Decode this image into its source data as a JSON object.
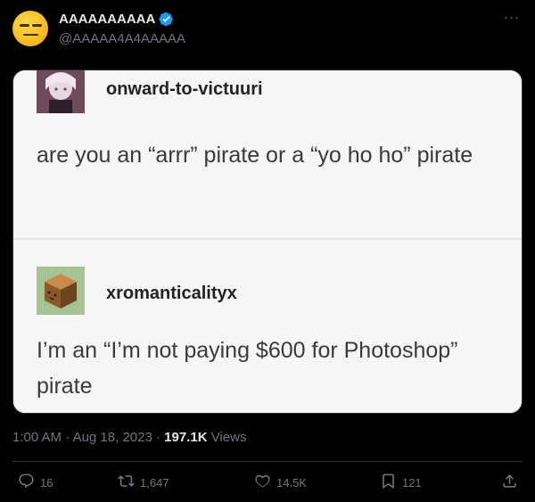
{
  "author": {
    "display_name": "AAAAAAAAAA",
    "handle": "@AAAAA4A4AAAAA"
  },
  "more_label": "···",
  "media": {
    "posts": [
      {
        "username": "onward-to-victuuri",
        "text": "are you an “arrr” pirate or a “yo ho ho” pirate"
      },
      {
        "username": "xromanticalityx",
        "text": "I’m an “I’m not paying $600 for Photoshop” pirate"
      }
    ]
  },
  "meta": {
    "time": "1:00 AM",
    "sep1": " · ",
    "date": "Aug 18, 2023",
    "sep2": " · ",
    "views_count": "197.1K",
    "views_label": " Views"
  },
  "actions": {
    "replies": "16",
    "retweets": "1,647",
    "likes": "14.5K",
    "bookmarks": "121"
  },
  "colors": {
    "background": "#000000",
    "text": "#e7e9ea",
    "muted": "#71767b",
    "verified": "#1d9bf0"
  }
}
